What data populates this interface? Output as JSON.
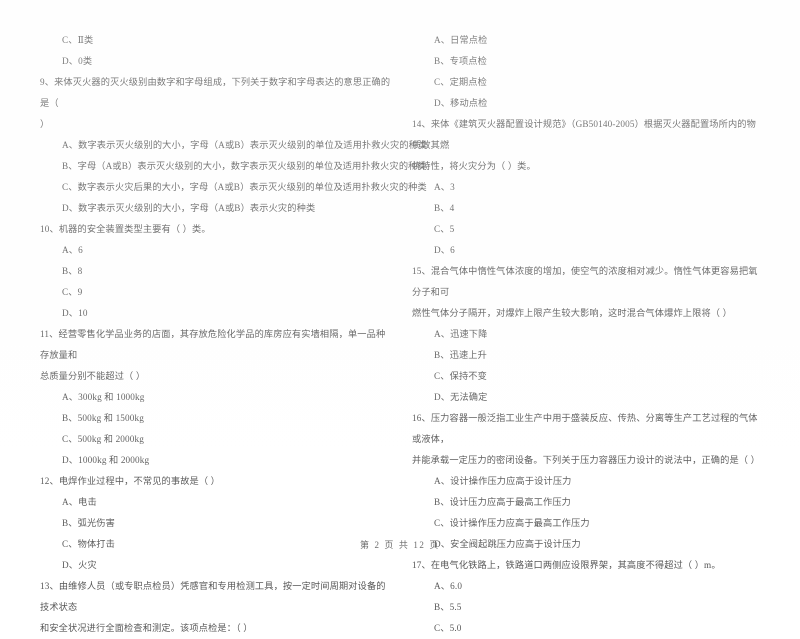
{
  "document": {
    "footer": "第 2 页 共 12 页",
    "ink_color": "#5a5a5a",
    "background_color": "#ffffff"
  },
  "left_column": {
    "orphan_options": [
      "C、Ⅱ类",
      "D、0类"
    ],
    "questions": [
      {
        "number": "9",
        "stem": "9、来体灭火器的灭火级别由数字和字母组成，下列关于数字和字母表达的意思正确的是（",
        "stem_cont": "）",
        "options": [
          "A、数字表示灭火级别的大小，字母（A或B）表示灭火级别的单位及适用扑救火灾的种类",
          "B、字母（A或B）表示灭火级别的大小，数字表示灭火级别的单位及适用扑救火灾的种类",
          "C、数字表示火灾后果的大小，字母（A或B）表示灭火级别的单位及适用扑救火灾的种类",
          "D、数字表示灭火级别的大小，字母（A或B）表示火灾的种类"
        ]
      },
      {
        "number": "10",
        "stem": "10、机器的安全装置类型主要有（     ）类。",
        "stem_cont": "",
        "options": [
          "A、6",
          "B、8",
          "C、9",
          "D、10"
        ]
      },
      {
        "number": "11",
        "stem": "11、经营零售化学品业务的店面，其存放危险化学品的库房应有实墙相隔，单一品种存放量和",
        "stem_cont": "总质量分别不能超过（     ）",
        "options": [
          "A、300kg 和 1000kg",
          "B、500kg 和 1500kg",
          "C、500kg 和 2000kg",
          "D、1000kg 和 2000kg"
        ]
      },
      {
        "number": "12",
        "stem": "12、电焊作业过程中，不常见的事故是（     ）",
        "stem_cont": "",
        "options": [
          "A、电击",
          "B、弧光伤害",
          "C、物体打击",
          "D、火灾"
        ]
      },
      {
        "number": "13",
        "stem": "13、由维修人员（或专职点检员）凭感官和专用检测工具，按一定时间周期对设备的技术状态",
        "stem_cont": "和安全状况进行全面检查和测定。该项点检是：（     ）",
        "options": []
      }
    ]
  },
  "right_column": {
    "orphan_options": [
      "A、日常点检",
      "B、专项点检",
      "C、定期点检",
      "D、移动点检"
    ],
    "questions": [
      {
        "number": "14",
        "stem": "14、来体《建筑灭火器配置设计规范》（GB50140-2005）根据灭火器配置场所内的物质效其燃",
        "stem_cont": "烧特性，将火灾分为（     ）类。",
        "options": [
          "A、3",
          "B、4",
          "C、5",
          "D、6"
        ]
      },
      {
        "number": "15",
        "stem": "15、混合气体中惰性气体浓度的增加，使空气的浓度相对减少。惰性气体更容易把氧分子和可",
        "stem_cont": "燃性气体分子隔开，对爆炸上限产生较大影响，这时混合气体爆炸上限将（     ）",
        "options": [
          "A、迅速下降",
          "B、迅速上升",
          "C、保持不变",
          "D、无法确定"
        ]
      },
      {
        "number": "16",
        "stem": "16、压力容器一般泛指工业生产中用于盛装反应、传热、分离等生产工艺过程的气体或液体，",
        "stem_cont": "并能承载一定压力的密闭设备。下列关于压力容器压力设计的说法中，正确的是（     ）",
        "options": [
          "A、设计操作压力应高于设计压力",
          "B、设计压力应高于最高工作压力",
          "C、设计操作压力应高于最高工作压力",
          "D、安全阀起跳压力应高于设计压力"
        ]
      },
      {
        "number": "17",
        "stem": "17、在电气化铁路上，铁路道口两侧应设限界架，其高度不得超过（     ）m。",
        "stem_cont": "",
        "options": [
          "A、6.0",
          "B、5.5",
          "C、5.0"
        ]
      }
    ]
  }
}
